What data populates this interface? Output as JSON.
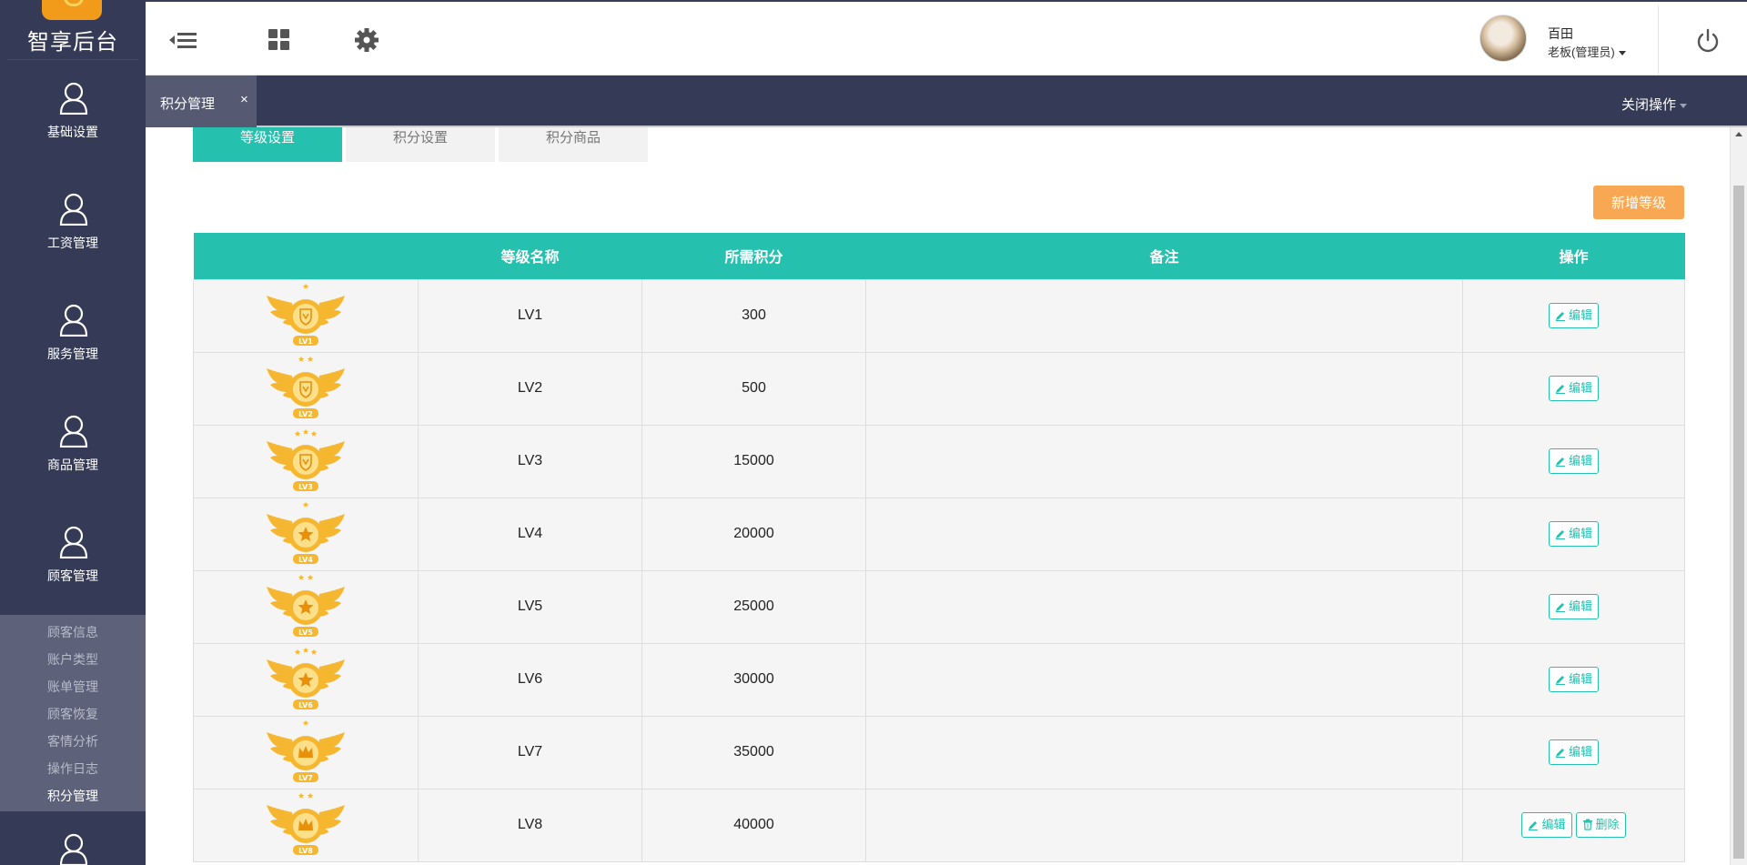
{
  "sidebar": {
    "logo_text": "智享后台",
    "nav": [
      {
        "label": "基础设置",
        "icon": "user-icon"
      },
      {
        "label": "工资管理",
        "icon": "user-icon"
      },
      {
        "label": "服务管理",
        "icon": "user-icon"
      },
      {
        "label": "商品管理",
        "icon": "user-icon"
      },
      {
        "label": "顾客管理",
        "icon": "user-icon"
      }
    ],
    "submenu": [
      "顾客信息",
      "账户类型",
      "账单管理",
      "顾客恢复",
      "客情分析",
      "操作日志",
      "积分管理"
    ],
    "submenu_active": "积分管理"
  },
  "header": {
    "menu_toggle_icon": "menu-collapse-icon",
    "grid_icon": "grid-icon",
    "settings_icon": "gear-icon",
    "user_name": "百田",
    "user_role": "老板(管理员)",
    "power_icon": "power-icon"
  },
  "tabbar": {
    "active_tab": "积分管理",
    "close_symbol": "×",
    "close_ops": "关闭操作"
  },
  "subtabs": [
    "等级设置",
    "积分设置",
    "积分商品"
  ],
  "subtab_active": "等级设置",
  "add_button": "新增等级",
  "table": {
    "headers": [
      "",
      "等级名称",
      "所需积分",
      "备注",
      "操作"
    ],
    "edit_label": "编辑",
    "delete_label": "删除",
    "rows": [
      {
        "badge": "LV1",
        "name": "LV1",
        "points": "300",
        "note": "",
        "stars": 1,
        "emblem": "shield"
      },
      {
        "badge": "LV2",
        "name": "LV2",
        "points": "500",
        "note": "",
        "stars": 2,
        "emblem": "shield"
      },
      {
        "badge": "LV3",
        "name": "LV3",
        "points": "15000",
        "note": "",
        "stars": 3,
        "emblem": "shield"
      },
      {
        "badge": "LV4",
        "name": "LV4",
        "points": "20000",
        "note": "",
        "stars": 1,
        "emblem": "star"
      },
      {
        "badge": "LV5",
        "name": "LV5",
        "points": "25000",
        "note": "",
        "stars": 2,
        "emblem": "star"
      },
      {
        "badge": "LV6",
        "name": "LV6",
        "points": "30000",
        "note": "",
        "stars": 3,
        "emblem": "star"
      },
      {
        "badge": "LV7",
        "name": "LV7",
        "points": "35000",
        "note": "",
        "stars": 1,
        "emblem": "crown"
      },
      {
        "badge": "LV8",
        "name": "LV8",
        "points": "40000",
        "note": "",
        "stars": 2,
        "emblem": "crown",
        "deletable": true
      }
    ]
  },
  "colors": {
    "sidebar_bg": "#353b56",
    "accent": "#26c0ae",
    "add_button": "#f8a852",
    "badge_gold": "#f5b730"
  }
}
